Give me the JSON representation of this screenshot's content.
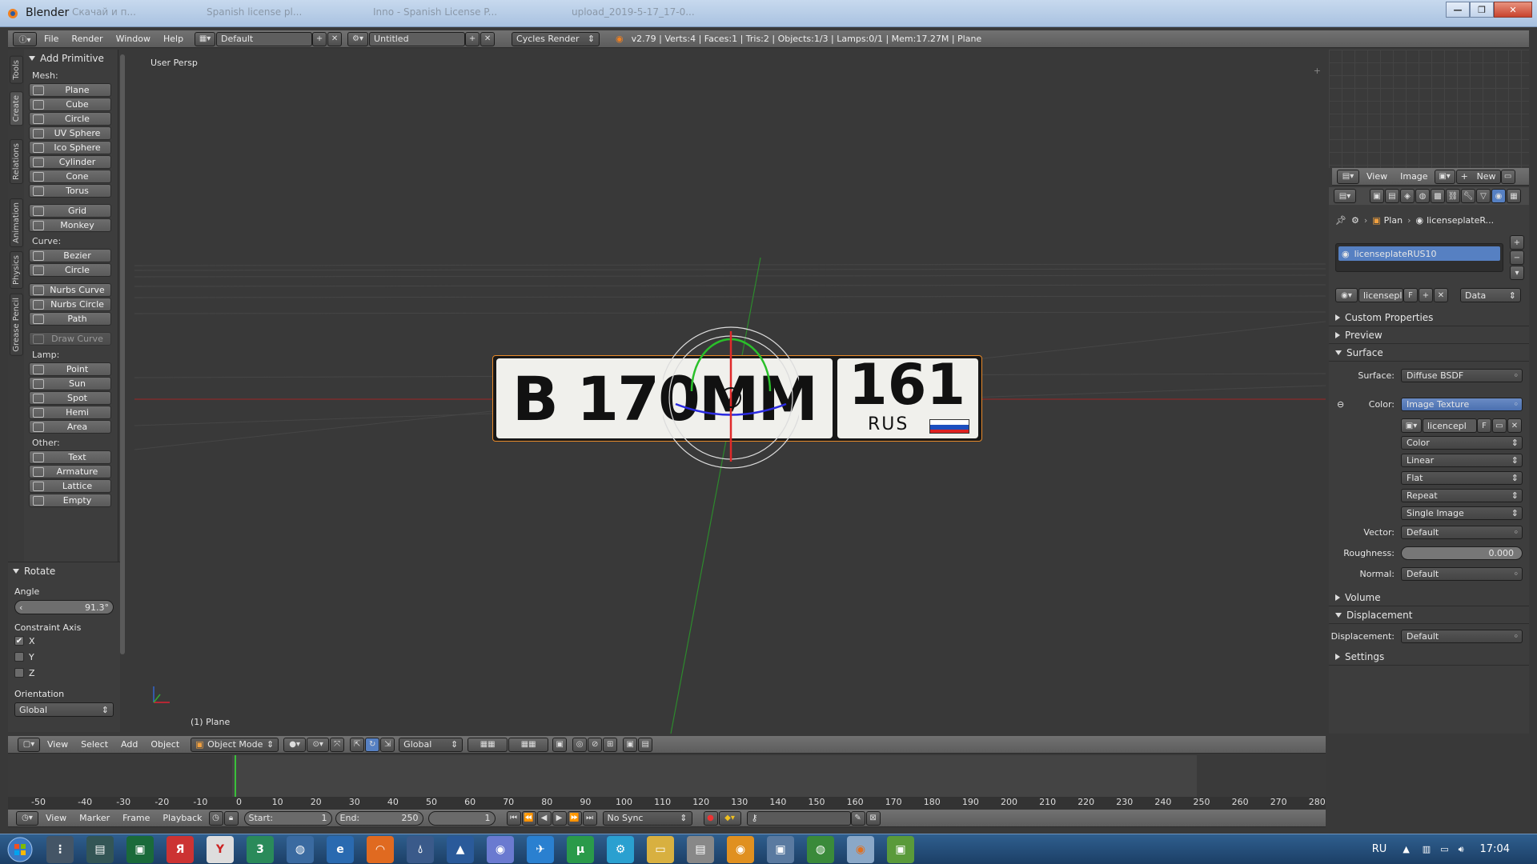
{
  "window": {
    "title": "Blender",
    "tabs": [
      "Скачай и п...",
      "Spanish license pl...",
      "Inno - Spanish License P...",
      "upload_2019-5-17_17-0..."
    ]
  },
  "topbar": {
    "menus": [
      "File",
      "Render",
      "Window",
      "Help"
    ],
    "layout": "Default",
    "scene": "Untitled",
    "engine": "Cycles Render",
    "stats": "v2.79 | Verts:4 | Faces:1 | Tris:2 | Objects:1/3 | Lamps:0/1 | Mem:17.27M | Plane"
  },
  "tabs": [
    "Tools",
    "Create",
    "Relations",
    "Animation",
    "Physics",
    "Grease Pencil"
  ],
  "toolshelf": {
    "title": "Add Primitive",
    "sections": [
      {
        "label": "Mesh:",
        "items": [
          {
            "label": "Plane",
            "icon": "plane-icon"
          },
          {
            "label": "Cube",
            "icon": "cube-icon"
          },
          {
            "label": "Circle",
            "icon": "circle-icon"
          },
          {
            "label": "UV Sphere",
            "icon": "uv-sphere-icon"
          },
          {
            "label": "Ico Sphere",
            "icon": "ico-sphere-icon"
          },
          {
            "label": "Cylinder",
            "icon": "cylinder-icon"
          },
          {
            "label": "Cone",
            "icon": "cone-icon"
          },
          {
            "label": "Torus",
            "icon": "torus-icon"
          },
          {
            "label": "Grid",
            "icon": "grid-icon"
          },
          {
            "label": "Monkey",
            "icon": "monkey-icon"
          }
        ]
      },
      {
        "label": "Curve:",
        "items": [
          {
            "label": "Bezier",
            "icon": "bezier-icon"
          },
          {
            "label": "Circle",
            "icon": "curve-circle-icon"
          },
          {
            "label": "Nurbs Curve",
            "icon": "nurbs-curve-icon"
          },
          {
            "label": "Nurbs Circle",
            "icon": "nurbs-circle-icon"
          },
          {
            "label": "Path",
            "icon": "path-icon"
          },
          {
            "label": "Draw Curve",
            "icon": "draw-curve-icon"
          }
        ]
      },
      {
        "label": "Lamp:",
        "items": [
          {
            "label": "Point",
            "icon": "point-lamp-icon"
          },
          {
            "label": "Sun",
            "icon": "sun-lamp-icon"
          },
          {
            "label": "Spot",
            "icon": "spot-lamp-icon"
          },
          {
            "label": "Hemi",
            "icon": "hemi-lamp-icon"
          },
          {
            "label": "Area",
            "icon": "area-lamp-icon"
          }
        ]
      },
      {
        "label": "Other:",
        "items": [
          {
            "label": "Text",
            "icon": "text-icon"
          },
          {
            "label": "Armature",
            "icon": "armature-icon"
          },
          {
            "label": "Lattice",
            "icon": "lattice-icon"
          },
          {
            "label": "Empty",
            "icon": "empty-icon"
          }
        ]
      }
    ]
  },
  "operator": {
    "title": "Rotate",
    "angle_label": "Angle",
    "angle": "91.3°",
    "axis_label": "Constraint Axis",
    "axes": [
      "X",
      "Y",
      "Z"
    ],
    "axis_checked": [
      true,
      false,
      false
    ],
    "orientation_label": "Orientation",
    "orientation": "Global"
  },
  "viewport": {
    "view_label": "User Persp",
    "object_label": "(1) Plane",
    "plate": {
      "left": "B 170MM",
      "region": "161",
      "country": "RUS"
    }
  },
  "view3d_header": {
    "menus": [
      "View",
      "Select",
      "Add",
      "Object"
    ],
    "mode": "Object Mode",
    "orientation": "Global"
  },
  "timeline": {
    "ticks": [
      -50,
      -40,
      -30,
      -20,
      -10,
      0,
      10,
      20,
      30,
      40,
      50,
      60,
      70,
      80,
      90,
      100,
      110,
      120,
      130,
      140,
      150,
      160,
      170,
      180,
      190,
      200,
      210,
      220,
      230,
      240,
      250,
      260,
      270,
      280
    ],
    "current_frame_marker": 1,
    "menus": [
      "View",
      "Marker",
      "Frame",
      "Playback"
    ],
    "start_label": "Start:",
    "start": "1",
    "end_label": "End:",
    "end": "250",
    "frame": "1",
    "sync": "No Sync"
  },
  "image_editor": {
    "menus": [
      "View",
      "Image"
    ],
    "new_label": "New"
  },
  "properties": {
    "breadcrumb": [
      "Plan",
      "licenseplateR..."
    ],
    "material_slot": "licenseplateRUS10",
    "material_name": "licensepl",
    "fake": "F",
    "link": "Data",
    "panels": {
      "custom": "Custom Properties",
      "preview": "Preview",
      "surface": "Surface",
      "volume": "Volume",
      "displacement": "Displacement",
      "settings": "Settings"
    },
    "surface": {
      "label": "Surface:",
      "value": "Diffuse BSDF"
    },
    "color": {
      "label": "Color:",
      "value": "Image Texture",
      "image": "licencepl",
      "image_fake": "F",
      "color_space": "Color",
      "interp": "Linear",
      "projection": "Flat",
      "extension": "Repeat",
      "source": "Single Image"
    },
    "vector": {
      "label": "Vector:",
      "value": "Default"
    },
    "roughness": {
      "label": "Roughness:",
      "value": "0.000"
    },
    "normal": {
      "label": "Normal:",
      "value": "Default"
    },
    "displacement": {
      "label": "Displacement:",
      "value": "Default"
    }
  },
  "taskbar": {
    "lang": "RU",
    "time": "17:04"
  }
}
